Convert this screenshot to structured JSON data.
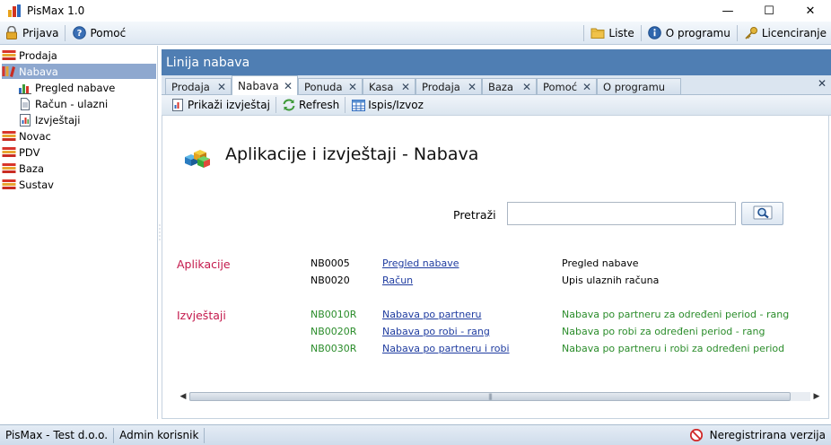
{
  "window": {
    "title": "PisMax 1.0"
  },
  "toolbar": {
    "left": [
      {
        "label": "Prijava",
        "icon": "lock-icon"
      },
      {
        "label": "Pomoć",
        "icon": "help-icon"
      }
    ],
    "right": [
      {
        "label": "Liste",
        "icon": "folder-icon"
      },
      {
        "label": "O programu",
        "icon": "info-icon"
      },
      {
        "label": "Licenciranje",
        "icon": "key-icon"
      }
    ]
  },
  "sidebar": {
    "items": [
      {
        "label": "Prodaja",
        "icon": "books-icon"
      },
      {
        "label": "Nabava",
        "icon": "books-icon",
        "selected": true
      },
      {
        "label": "Pregled nabave",
        "icon": "chart-icon"
      },
      {
        "label": "Račun - ulazni",
        "icon": "document-icon"
      },
      {
        "label": "Izvještaji",
        "icon": "report-icon"
      },
      {
        "label": "Novac",
        "icon": "books-icon"
      },
      {
        "label": "PDV",
        "icon": "books-icon"
      },
      {
        "label": "Baza",
        "icon": "books-icon"
      },
      {
        "label": "Sustav",
        "icon": "books-icon"
      }
    ]
  },
  "panel": {
    "title": "Linija nabava",
    "tabs": [
      "Prodaja",
      "Nabava",
      "Ponuda",
      "Kasa",
      "Prodaja",
      "Baza",
      "Pomoć",
      "O programu"
    ],
    "active_tab": "Nabava",
    "subtoolbar": [
      {
        "label": "Prikaži izvještaj",
        "icon": "report-view-icon"
      },
      {
        "label": "Refresh",
        "icon": "refresh-icon"
      },
      {
        "label": "Ispis/Izvoz",
        "icon": "table-icon"
      }
    ]
  },
  "content": {
    "title": "Aplikacije i izvještaji - Nabava",
    "search_label": "Pretraži",
    "search_value": "",
    "sections": [
      {
        "label": "Aplikacije",
        "rows": [
          {
            "code": "NB0005",
            "link": "Pregled nabave",
            "desc": "Pregled nabave"
          },
          {
            "code": "NB0020",
            "link": "Račun",
            "desc": "Upis ulaznih računa"
          }
        ]
      },
      {
        "label": "Izvještaji",
        "rows": [
          {
            "code": "NB0010R",
            "link": "Nabava po partneru",
            "desc": "Nabava po partneru  za određeni period - rang"
          },
          {
            "code": "NB0020R",
            "link": "Nabava po robi - rang",
            "desc": "Nabava po robi  za određeni period - rang"
          },
          {
            "code": "NB0030R",
            "link": "Nabava po partneru i robi ",
            "desc": "Nabava po partneru i robi  za određeni period"
          }
        ]
      }
    ]
  },
  "statusbar": {
    "company": "PisMax - Test d.o.o.",
    "user": "Admin korisnik",
    "registration": "Neregistrirana verzija"
  },
  "colors": {
    "header_blue": "#4f7eb3",
    "selected_item": "#8ea8cf",
    "section_red": "#c4194c",
    "report_green": "#2a8c2a",
    "link_blue": "#1f3ca0"
  }
}
